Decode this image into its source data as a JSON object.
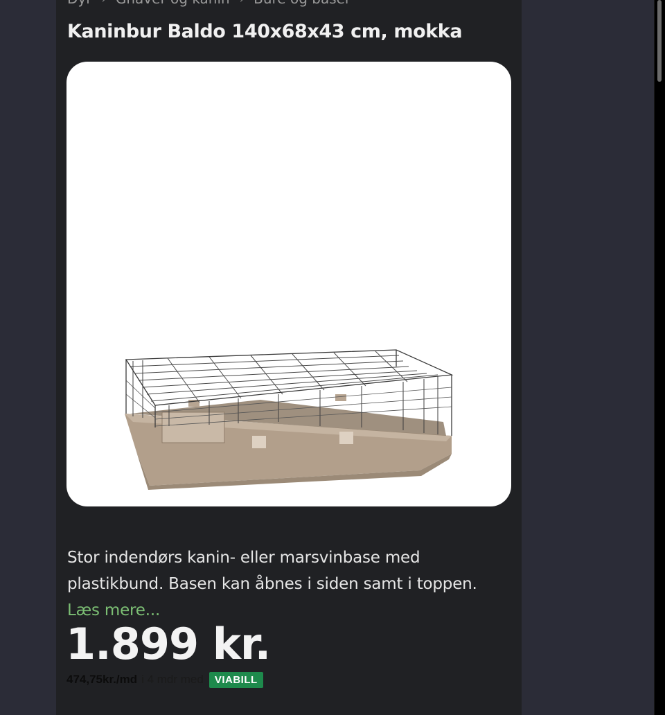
{
  "breadcrumb": {
    "items": [
      "Dyr",
      "Gnaver og kanin",
      "Bure og baser"
    ]
  },
  "product": {
    "title": "Kaninbur Baldo 140x68x43 cm, mokka",
    "image_alt": "Kaninbur Baldo",
    "description": "Stor indendørs kanin- eller marsvinbase med plastikbund. Basen kan åbnes i siden samt i toppen.",
    "read_more": "Læs mere...",
    "price": "1.899 kr."
  },
  "installment": {
    "amount": "474,75kr./md",
    "text": "i 4 mdr med",
    "provider": "VIABILL"
  },
  "colors": {
    "background": "#2b2c37",
    "content": "#202124",
    "link": "#7cbf74",
    "badge": "#1e8a4c"
  }
}
